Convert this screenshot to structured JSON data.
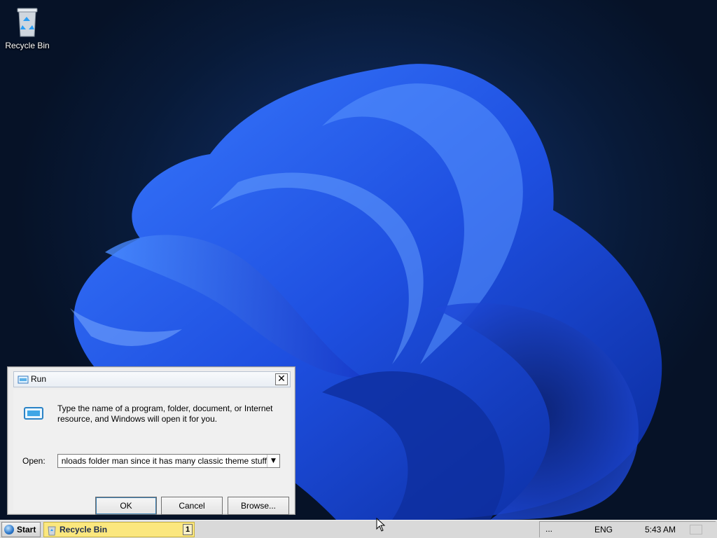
{
  "desktop": {
    "icons": [
      {
        "label": "Recycle Bin",
        "icon": "recycle-bin-icon"
      }
    ]
  },
  "run_dialog": {
    "title": "Run",
    "close_glyph": "✕",
    "description": "Type the name of a program, folder, document, or Internet resource, and Windows will open it for you.",
    "open_label": "Open:",
    "open_value": "nloads folder man since it has many classic theme stuff",
    "dropdown_glyph": "▼",
    "buttons": {
      "ok": "OK",
      "cancel": "Cancel",
      "browse": "Browse..."
    }
  },
  "taskbar": {
    "start_label": "Start",
    "task_button": {
      "label": "Recycle Bin",
      "count": "1"
    },
    "tray": {
      "more": "...",
      "language": "ENG",
      "time": "5:43 AM"
    }
  },
  "colors": {
    "desktop_bg": "#07152e",
    "bloom_blue": "#1f5cff",
    "taskbar": "#d9d9d9",
    "task_button_active": "#fbe77e"
  }
}
